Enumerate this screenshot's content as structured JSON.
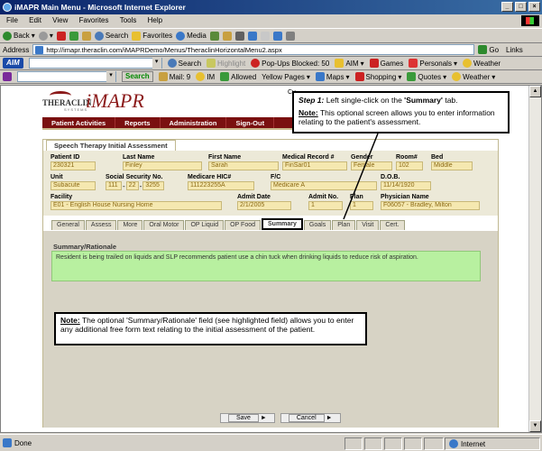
{
  "window": {
    "title": "iMAPR Main Menu - Microsoft Internet Explorer",
    "controls": [
      "_",
      "□",
      "×"
    ]
  },
  "menubar": [
    "File",
    "Edit",
    "View",
    "Favorites",
    "Tools",
    "Help"
  ],
  "toolbar": {
    "back": "Back",
    "search": "Search",
    "favorites": "Favorites",
    "media": "Media"
  },
  "address": {
    "label": "Address",
    "url": "http://imapr.theraclin.com/iMAPRDemo/Menus/TheraclinHorizontalMenu2.aspx",
    "go": "Go",
    "links": "Links"
  },
  "aimbar": {
    "logo": "AIM",
    "search": "Search",
    "highlight": "Highlight",
    "popups": "Pop-Ups Blocked: 50",
    "aim": "AIM",
    "games": "Games",
    "personals": "Personals",
    "weather": "Weather"
  },
  "yahoobar": {
    "search": "Search",
    "mail": "Mail: 9",
    "im": "IM",
    "allowed": "Allowed",
    "yellow_pages": "Yellow Pages",
    "maps": "Maps",
    "shopping": "Shopping",
    "quotes": "Quotes",
    "weather": "Weather"
  },
  "app": {
    "logo_thera": "THERACLIN",
    "logo_sys": "SYSTEMS",
    "logo_name": "iMAPR",
    "cut_text": "Cu",
    "nav": [
      "Patient Activities",
      "Reports",
      "Administration",
      "Sign-Out"
    ],
    "panel_title": "Speech Therapy Initial Assessment",
    "patient": {
      "patient_id": {
        "label": "Patient ID",
        "value": "230321"
      },
      "last_name": {
        "label": "Last Name",
        "value": "Finley"
      },
      "first_name": {
        "label": "First Name",
        "value": "Sarah"
      },
      "medical_record": {
        "label": "Medical Record #",
        "value": "FinSar01"
      },
      "gender": {
        "label": "Gender",
        "value": "Female"
      },
      "room": {
        "label": "Room#",
        "value": "102"
      },
      "bed": {
        "label": "Bed",
        "value": "Middle"
      },
      "unit": {
        "label": "Unit",
        "value": "Subacute"
      },
      "ssn": {
        "label": "Social Security No.",
        "parts": [
          "111",
          "22",
          "3255"
        ]
      },
      "medicare": {
        "label": "Medicare HIC#",
        "value": "111223255A"
      },
      "fc": {
        "label": "F/C",
        "value": "Medicare A"
      },
      "dob": {
        "label": "D.O.B.",
        "value": "11/14/1920"
      },
      "facility": {
        "label": "Facility",
        "value": "E01 - English House Nursing Home"
      },
      "admit_date": {
        "label": "Admit Date",
        "value": "2/1/2005"
      },
      "admit_no": {
        "label": "Admit No.",
        "value": "1"
      },
      "plan": {
        "label": "Plan",
        "value": "1"
      },
      "physician": {
        "label": "Physician Name",
        "value": "F06057 - Bradley, Milton"
      }
    },
    "tabs": [
      "General",
      "Assess",
      "More",
      "Oral Motor",
      "OP Liquid",
      "OP Food",
      "Summary",
      "Goals",
      "Plan",
      "Visit",
      "Cert."
    ],
    "active_tab": "Summary",
    "summary_label": "Summary/Rationale",
    "summary_text": "Resident is being trailed on liquids and SLP recommends patient use a chin tuck when drinking liquids to reduce risk of aspiration.",
    "buttons": {
      "save": "Save",
      "cancel": "Cancel"
    }
  },
  "callout1": {
    "step": "Step 1:",
    "step_text": " Left single-click on the ",
    "step_target": "'Summary'",
    "step_end": " tab.",
    "note": "Note:",
    "note_text": " This optional screen allows you to enter information relating to the patient's assessment."
  },
  "callout2": {
    "note": "Note:",
    "note_text": " The optional 'Summary/Rationale' field (see highlighted field) allows you to enter any additional free form text relating to the initial assessment of the patient."
  },
  "status": {
    "left": "Done",
    "zone": "Internet"
  },
  "colors": {
    "nav_bg": "#7a1010",
    "summary_highlight": "#b8f0a0",
    "field_bg": "#f5e8b0"
  }
}
